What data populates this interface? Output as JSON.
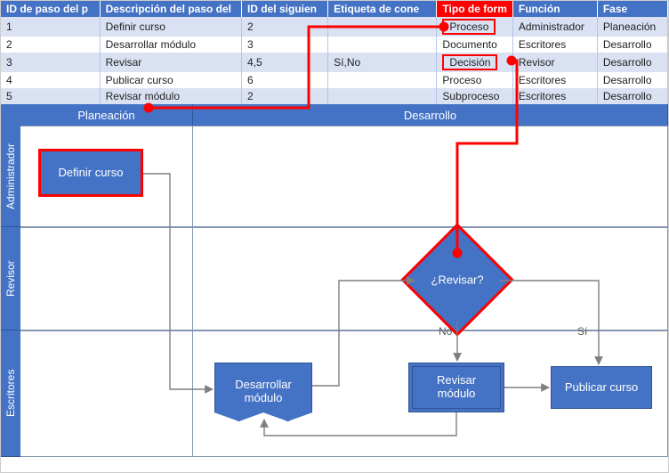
{
  "table": {
    "headers": [
      "ID de paso del p",
      "Descripción del paso del",
      "ID del siguien",
      "Etiqueta de cone",
      "Tipo de form",
      "Función",
      "Fase"
    ],
    "rows": [
      {
        "id": "1",
        "desc": "Definir curso",
        "next": "2",
        "label": "",
        "shape": "Proceso",
        "role": "Administrador",
        "phase": "Planeación",
        "shape_boxed": true
      },
      {
        "id": "2",
        "desc": "Desarrollar módulo",
        "next": "3",
        "label": "",
        "shape": "Documento",
        "role": "Escritores",
        "phase": "Desarrollo"
      },
      {
        "id": "3",
        "desc": "Revisar",
        "next": "4,5",
        "label": "Sí,No",
        "shape": "Decisión",
        "role": "Revisor",
        "phase": "Desarrollo",
        "shape_boxed": true
      },
      {
        "id": "4",
        "desc": "Publicar curso",
        "next": "6",
        "label": "",
        "shape": "Proceso",
        "role": "Escritores",
        "phase": "Desarrollo"
      },
      {
        "id": "5",
        "desc": "Revisar módulo",
        "next": "2",
        "label": "",
        "shape": "Subproceso",
        "role": "Escritores",
        "phase": "Desarrollo"
      }
    ]
  },
  "phases": {
    "plan": "Planeación",
    "dev": "Desarrollo"
  },
  "roles": {
    "admin": "Administrador",
    "reviewer": "Revisor",
    "writers": "Escritores"
  },
  "shapes": {
    "define": "Definir curso",
    "develop_l1": "Desarrollar",
    "develop_l2": "módulo",
    "review_q": "¿Revisar?",
    "review_mod_l1": "Revisar",
    "review_mod_l2": "módulo",
    "publish": "Publicar curso"
  },
  "labels": {
    "no": "No",
    "si": "Sí"
  },
  "chart_data": {
    "type": "swimlane-flowchart",
    "phases": [
      "Planeación",
      "Desarrollo"
    ],
    "lanes": [
      "Administrador",
      "Revisor",
      "Escritores"
    ],
    "nodes": [
      {
        "id": 1,
        "label": "Definir curso",
        "shape": "process",
        "lane": "Administrador",
        "phase": "Planeación",
        "highlighted": true
      },
      {
        "id": 2,
        "label": "Desarrollar módulo",
        "shape": "document",
        "lane": "Escritores",
        "phase": "Desarrollo"
      },
      {
        "id": 3,
        "label": "¿Revisar?",
        "shape": "decision",
        "lane": "Revisor",
        "phase": "Desarrollo",
        "highlighted": true
      },
      {
        "id": 4,
        "label": "Publicar curso",
        "shape": "process",
        "lane": "Escritores",
        "phase": "Desarrollo"
      },
      {
        "id": 5,
        "label": "Revisar módulo",
        "shape": "subprocess",
        "lane": "Escritores",
        "phase": "Desarrollo"
      }
    ],
    "edges": [
      {
        "from": 1,
        "to": 2,
        "label": ""
      },
      {
        "from": 2,
        "to": 3,
        "label": ""
      },
      {
        "from": 3,
        "to": 5,
        "label": "No"
      },
      {
        "from": 3,
        "to": 4,
        "label": "Sí"
      },
      {
        "from": 5,
        "to": 2,
        "label": ""
      }
    ],
    "callouts": [
      {
        "target_header": "Tipo de form",
        "highlight": true
      },
      {
        "link": [
          "table.rows.0.shape",
          "nodes.1"
        ]
      },
      {
        "link": [
          "table.rows.2.shape",
          "nodes.3"
        ]
      }
    ]
  }
}
